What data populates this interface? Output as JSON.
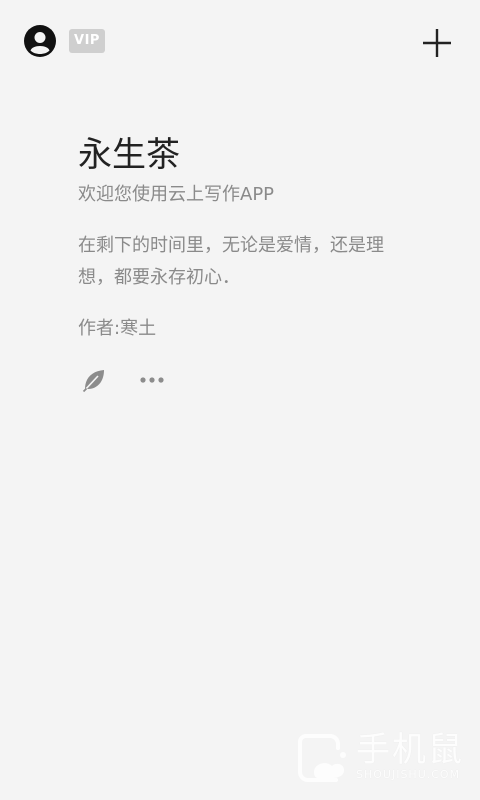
{
  "header": {
    "vip_label": "VIP",
    "avatar_icon": "user-avatar-icon",
    "add_icon": "plus-icon"
  },
  "card": {
    "title": "永生茶",
    "subtitle": "欢迎您使用云上写作APP",
    "quote": "在剩下的时间里，无论是爱情，还是理想，都要永存初心．",
    "author": "作者:寒土"
  },
  "actions": {
    "leaf_icon": "leaf-icon",
    "more_icon": "more-dots-icon"
  },
  "watermark": {
    "text": "手机鼠",
    "sub": "SHOUJISHU.COM"
  },
  "colors": {
    "background": "#f4f4f4",
    "title": "#222222",
    "secondary_text": "#8a8a8a",
    "vip_badge": "#cfcfcf"
  }
}
